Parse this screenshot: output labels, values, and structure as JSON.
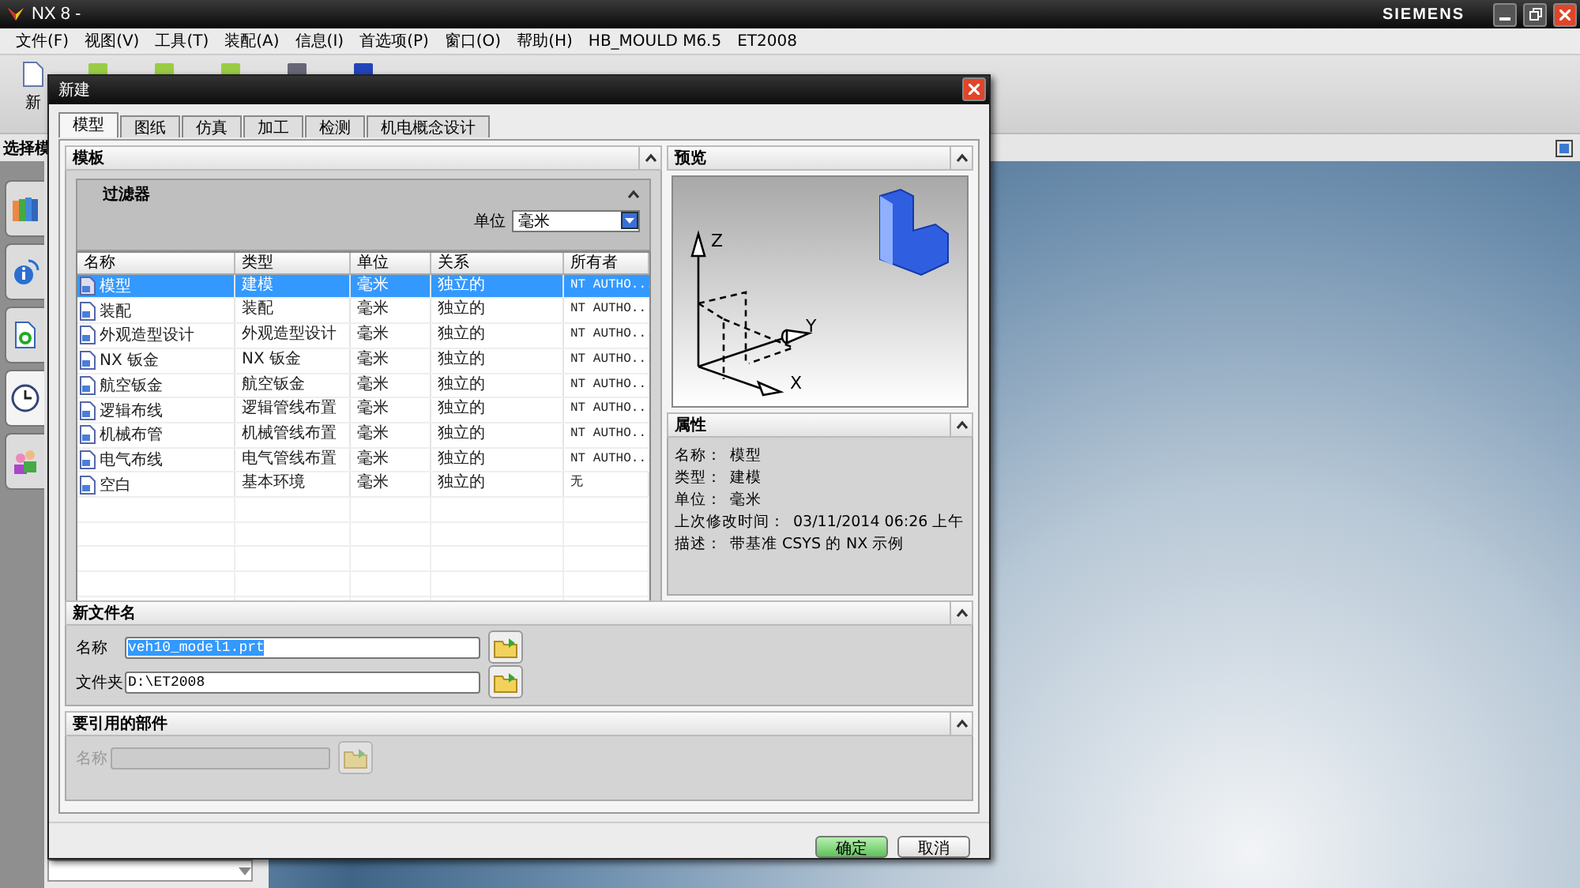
{
  "app": {
    "title": "NX 8 -",
    "brand": "SIEMENS",
    "menu": [
      "文件(F)",
      "视图(V)",
      "工具(T)",
      "装配(A)",
      "信息(I)",
      "首选项(P)",
      "窗口(O)",
      "帮助(H)",
      "HB_MOULD M6.5",
      "ET2008"
    ],
    "toolbar_label": "新",
    "resource_bar_label": "选择模",
    "rail_tabs": [
      {
        "kind": "books",
        "selected": false
      },
      {
        "kind": "info",
        "selected": false
      },
      {
        "kind": "document",
        "selected": false
      },
      {
        "kind": "clock",
        "selected": true
      },
      {
        "kind": "people",
        "selected": false
      }
    ]
  },
  "dialog": {
    "title": "新建",
    "tabs": [
      {
        "label": "模型",
        "selected": true
      },
      {
        "label": "图纸",
        "selected": false
      },
      {
        "label": "仿真",
        "selected": false
      },
      {
        "label": "加工",
        "selected": false
      },
      {
        "label": "检测",
        "selected": false
      },
      {
        "label": "机电概念设计",
        "selected": false
      }
    ],
    "templates": {
      "title": "模板",
      "filter_title": "过滤器",
      "unit_label": "单位",
      "unit_value": "毫米",
      "columns": [
        "名称",
        "类型",
        "单位",
        "关系",
        "所有者"
      ],
      "rows": [
        {
          "name": "模型",
          "type": "建模",
          "unit": "毫米",
          "relation": "独立的",
          "owner": "NT AUTHO...",
          "selected": true
        },
        {
          "name": "装配",
          "type": "装配",
          "unit": "毫米",
          "relation": "独立的",
          "owner": "NT AUTHO...",
          "selected": false
        },
        {
          "name": "外观造型设计",
          "type": "外观造型设计",
          "unit": "毫米",
          "relation": "独立的",
          "owner": "NT AUTHO...",
          "selected": false
        },
        {
          "name": "NX 钣金",
          "type": "NX 钣金",
          "unit": "毫米",
          "relation": "独立的",
          "owner": "NT AUTHO...",
          "selected": false
        },
        {
          "name": "航空钣金",
          "type": "航空钣金",
          "unit": "毫米",
          "relation": "独立的",
          "owner": "NT AUTHO...",
          "selected": false
        },
        {
          "name": "逻辑布线",
          "type": "逻辑管线布置",
          "unit": "毫米",
          "relation": "独立的",
          "owner": "NT AUTHO...",
          "selected": false
        },
        {
          "name": "机械布管",
          "type": "机械管线布置",
          "unit": "毫米",
          "relation": "独立的",
          "owner": "NT AUTHO...",
          "selected": false
        },
        {
          "name": "电气布线",
          "type": "电气管线布置",
          "unit": "毫米",
          "relation": "独立的",
          "owner": "NT AUTHO...",
          "selected": false
        },
        {
          "name": "空白",
          "type": "基本环境",
          "unit": "毫米",
          "relation": "独立的",
          "owner": "无",
          "selected": false
        }
      ]
    },
    "preview": {
      "title": "预览",
      "axes": [
        "Z",
        "Y",
        "X"
      ]
    },
    "properties": {
      "title": "属性",
      "items": [
        {
          "label": "名称：",
          "value": "模型"
        },
        {
          "label": "类型：",
          "value": "建模"
        },
        {
          "label": "单位：",
          "value": "毫米"
        },
        {
          "label": "上次修改时间：",
          "value": "03/11/2014 06:26 上午"
        },
        {
          "label": "描述：",
          "value": "带基准 CSYS 的 NX 示例"
        }
      ]
    },
    "new_file": {
      "title": "新文件名",
      "fields": [
        {
          "label": "名称",
          "value": "veh10_model1.prt",
          "highlighted": true
        },
        {
          "label": "文件夹",
          "value": "D:\\ET2008",
          "highlighted": false
        }
      ]
    },
    "referenced_part": {
      "title": "要引用的部件",
      "label": "名称",
      "disabled": true
    },
    "buttons": [
      {
        "label": "确定",
        "default": true
      },
      {
        "label": "取消",
        "default": false
      }
    ]
  }
}
